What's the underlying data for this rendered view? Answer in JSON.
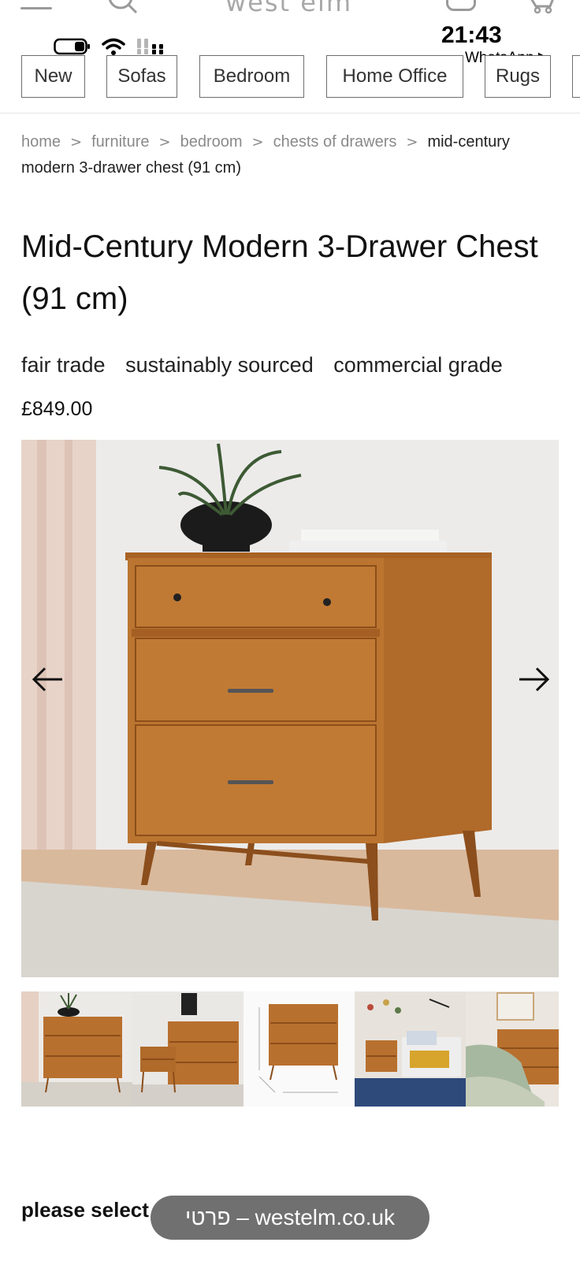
{
  "header": {
    "brand": "west elm"
  },
  "status_bar": {
    "time": "21:43",
    "back_app": "WhatsApp ▶"
  },
  "categories": [
    {
      "label": "New"
    },
    {
      "label": "Sofas"
    },
    {
      "label": "Bedroom"
    },
    {
      "label": "Home Office"
    },
    {
      "label": "Rugs"
    }
  ],
  "breadcrumb": {
    "items": [
      "home",
      "furniture",
      "bedroom",
      "chests of drawers"
    ],
    "current": "mid-century modern 3-drawer chest (91 cm)"
  },
  "product": {
    "title": "Mid-Century Modern 3-Drawer Chest (91 cm)",
    "tags": [
      "fair trade",
      "sustainably sourced",
      "commercial grade"
    ],
    "price": "£849.00"
  },
  "gallery": {
    "thumbnail_count": 5
  },
  "bottom": {
    "select_label": "please select",
    "url_pill": "פרטי – westelm.co.uk"
  },
  "colors": {
    "wood": "#b8702e",
    "wood_dark": "#9a5a22",
    "wall": "#eceae8",
    "rug": "#d8d5cf",
    "pill_bg": "#707070"
  }
}
